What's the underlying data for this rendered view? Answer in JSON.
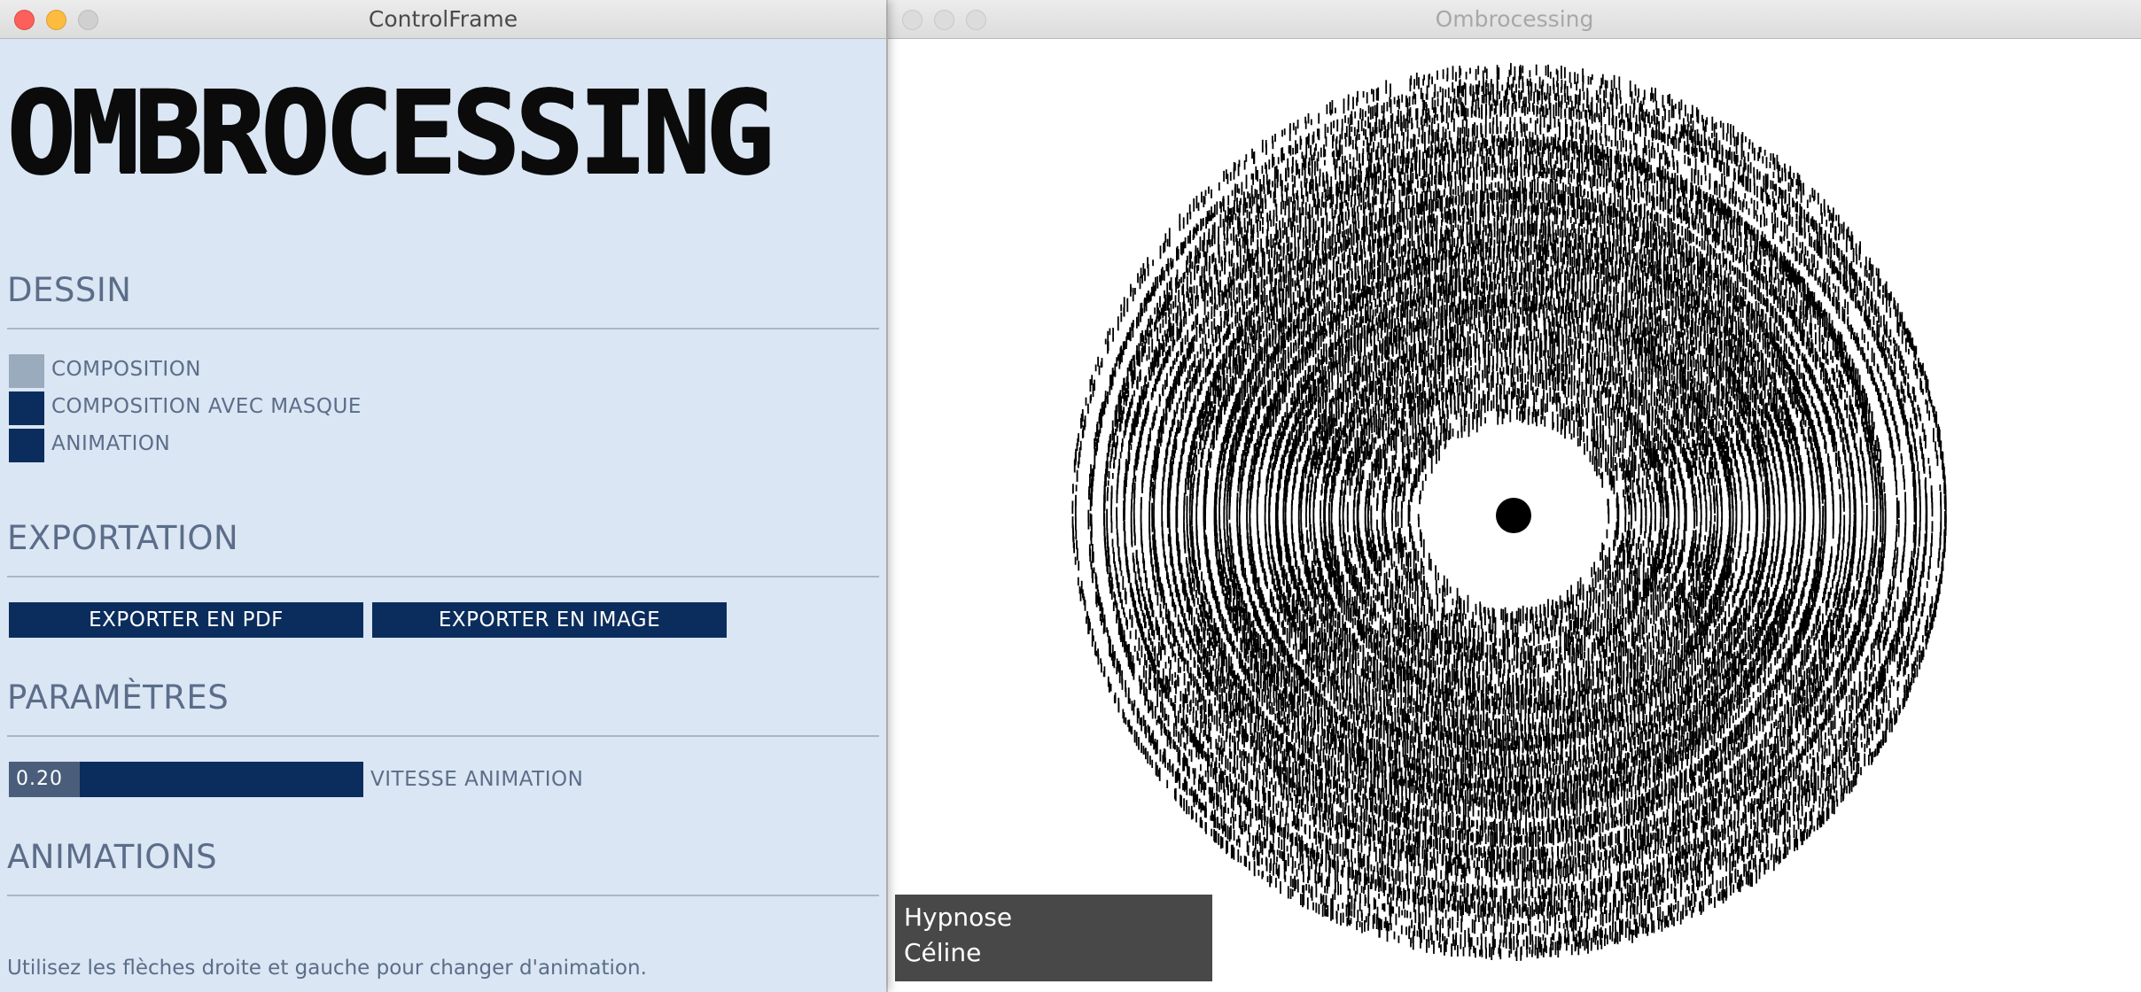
{
  "control_window": {
    "title": "ControlFrame",
    "app_title": "OMBROCESSING",
    "sections": {
      "dessin": "DESSIN",
      "exportation": "EXPORTATION",
      "parametres": "PARAMÈTRES",
      "animations": "ANIMATIONS"
    },
    "toggles": [
      {
        "label": "COMPOSITION",
        "active": false,
        "color": "#9aabbd"
      },
      {
        "label": "COMPOSITION AVEC MASQUE",
        "active": true,
        "color": "#0b2d5d"
      },
      {
        "label": "ANIMATION",
        "active": true,
        "color": "#0b2d5d"
      }
    ],
    "export_buttons": {
      "pdf": "EXPORTER EN PDF",
      "image": "EXPORTER EN IMAGE"
    },
    "slider": {
      "value_text": "0.20",
      "value": 0.2,
      "min": 0,
      "max": 1,
      "label": "VITESSE ANIMATION"
    },
    "help_text": "Utilisez les flèches droite et gauche pour changer d'animation."
  },
  "canvas_window": {
    "title": "Ombrocessing",
    "overlay": {
      "line1": "Hypnose",
      "line2": "Céline"
    }
  },
  "colors": {
    "panel_bg": "#dae6f3",
    "accent": "#0b2d5d",
    "text": "#5c6d8a"
  }
}
